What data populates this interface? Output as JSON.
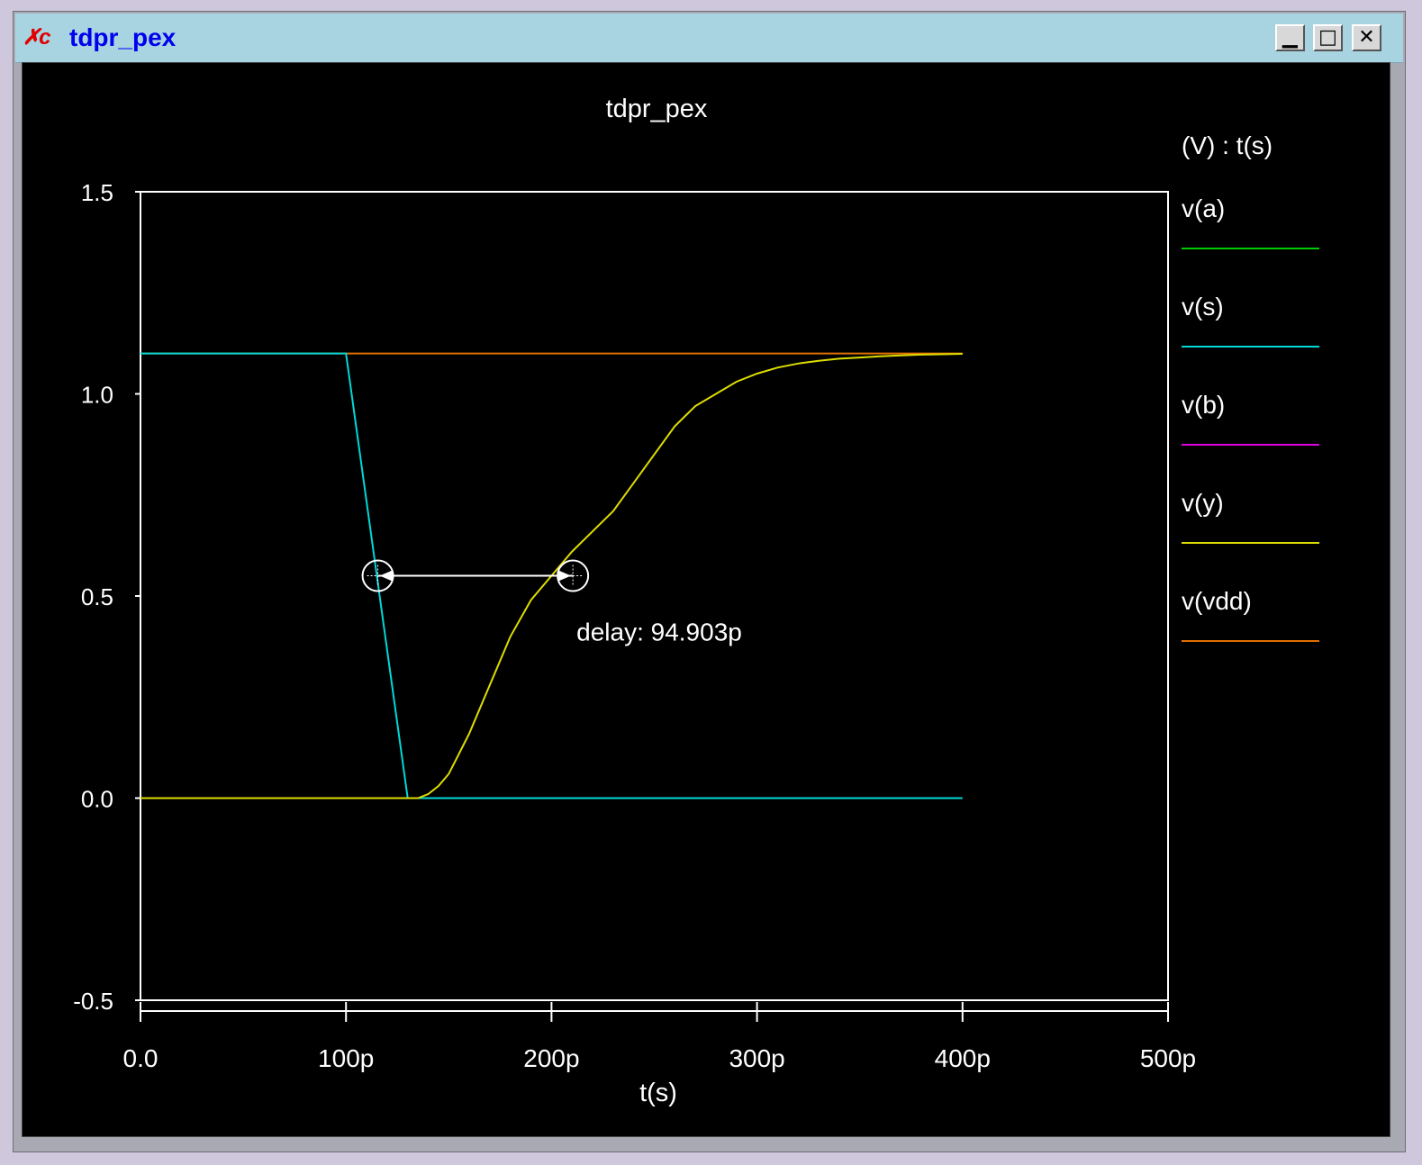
{
  "window": {
    "title": "tdpr_pex",
    "icon": "app-logo-icon",
    "controls": [
      "minimize-icon",
      "maximize-icon",
      "close-icon"
    ],
    "colors": {
      "titlebar": "#a8d4e2",
      "title_text": "#0000ee",
      "icon": "#e00000"
    }
  },
  "chart_data": {
    "type": "line",
    "title": "tdpr_pex",
    "xlabel": "t(s)",
    "ylabel": "",
    "legend_header": "(V) : t(s)",
    "legend_position": "right",
    "xlim": [
      0,
      500
    ],
    "ylim": [
      -0.5,
      1.5
    ],
    "x_unit": "ps",
    "x_ticks": [
      0,
      100,
      200,
      300,
      400,
      500
    ],
    "x_tick_labels": [
      "0.0",
      "100p",
      "200p",
      "300p",
      "400p",
      "500p"
    ],
    "y_ticks": [
      1.5,
      1.0,
      0.5,
      0.0,
      -0.5
    ],
    "y_tick_labels": [
      "1.5",
      "1.0",
      "0.5",
      "0.0",
      "-0.5"
    ],
    "grid": false,
    "series": [
      {
        "name": "v(a)",
        "color": "#00cc00",
        "x": [],
        "y": []
      },
      {
        "name": "v(s)",
        "color": "#00d8d8",
        "x": [
          0,
          100,
          130,
          400
        ],
        "y": [
          1.1,
          1.1,
          0.0,
          0.0
        ]
      },
      {
        "name": "v(b)",
        "color": "#e000e0",
        "x": [],
        "y": []
      },
      {
        "name": "v(y)",
        "color": "#dddd00",
        "x": [
          0,
          135,
          140,
          145,
          150,
          160,
          170,
          180,
          190,
          200,
          210,
          220,
          230,
          240,
          250,
          260,
          270,
          280,
          290,
          300,
          310,
          320,
          330,
          340,
          350,
          360,
          370,
          380,
          390,
          400
        ],
        "y": [
          0.0,
          0.0,
          0.01,
          0.03,
          0.06,
          0.16,
          0.28,
          0.4,
          0.49,
          0.55,
          0.61,
          0.66,
          0.71,
          0.78,
          0.85,
          0.92,
          0.97,
          1.0,
          1.03,
          1.05,
          1.065,
          1.075,
          1.082,
          1.087,
          1.09,
          1.093,
          1.095,
          1.097,
          1.098,
          1.099
        ]
      },
      {
        "name": "v(vdd)",
        "color": "#e07000",
        "x": [
          0,
          400
        ],
        "y": [
          1.1,
          1.1
        ]
      }
    ],
    "measurement": {
      "label": "delay: 94.903p",
      "start": {
        "x": 115.5,
        "y": 0.55
      },
      "end": {
        "x": 210.4,
        "y": 0.55
      }
    },
    "colors": {
      "background": "#000000",
      "axes": "#ffffff",
      "text": "#ffffff"
    }
  }
}
